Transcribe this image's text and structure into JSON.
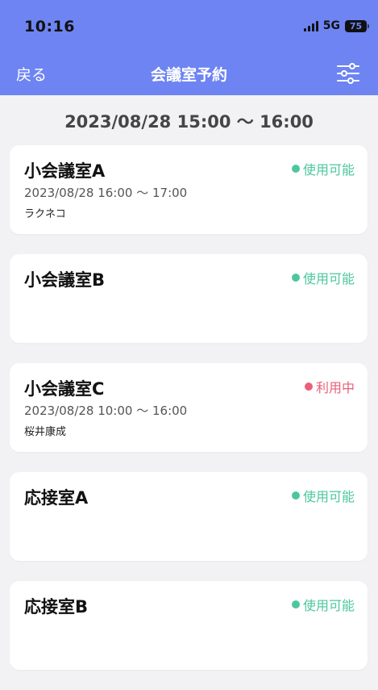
{
  "status_bar": {
    "time": "10:16",
    "network": "5G",
    "battery": "75"
  },
  "nav": {
    "back_label": "戻る",
    "title": "会議室予約",
    "filter_icon": "sliders-icon"
  },
  "date_range": "2023/08/28 15:00 〜 16:00",
  "colors": {
    "header": "#6d84f2",
    "available": "#4cc79c",
    "in_use": "#e8607a",
    "background": "#f2f2f4"
  },
  "rooms": [
    {
      "name": "小会議室A",
      "status": "使用可能",
      "status_type": "available",
      "time": "2023/08/28 16:00 〜 17:00",
      "user": "ラクネコ"
    },
    {
      "name": "小会議室B",
      "status": "使用可能",
      "status_type": "available",
      "time": "",
      "user": ""
    },
    {
      "name": "小会議室C",
      "status": "利用中",
      "status_type": "in_use",
      "time": "2023/08/28 10:00 〜 16:00",
      "user": "桜井康成"
    },
    {
      "name": "応接室A",
      "status": "使用可能",
      "status_type": "available",
      "time": "",
      "user": ""
    },
    {
      "name": "応接室B",
      "status": "使用可能",
      "status_type": "available",
      "time": "",
      "user": ""
    }
  ]
}
